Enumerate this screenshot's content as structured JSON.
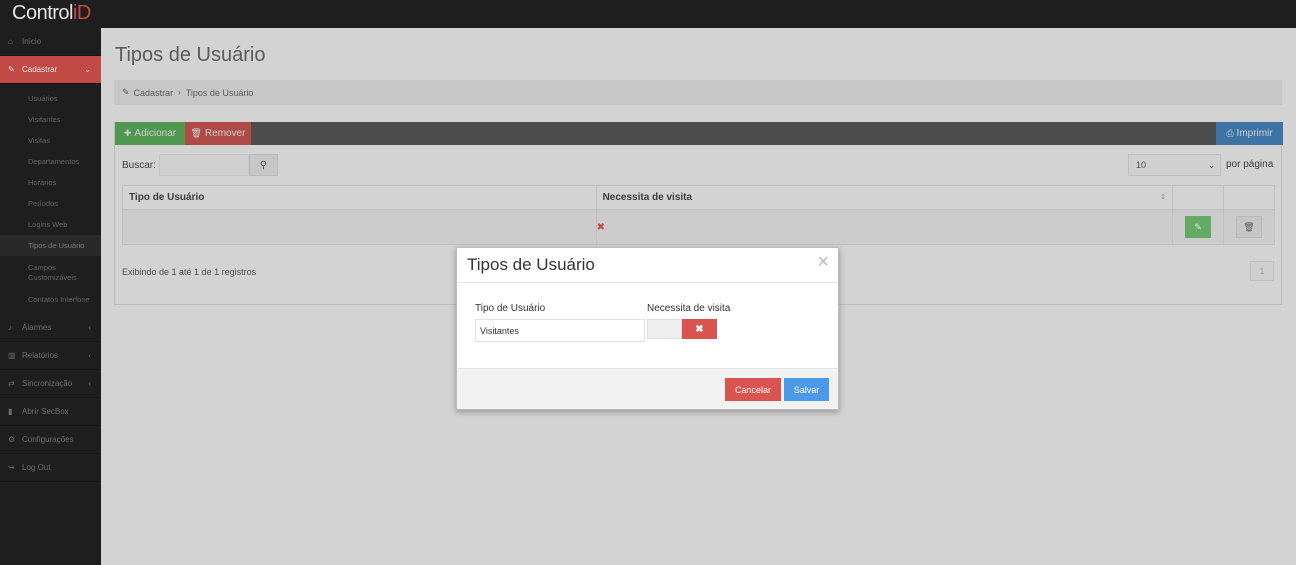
{
  "app": {
    "logo_text": "Control",
    "logo_accent": "iD"
  },
  "sidebar": {
    "items": [
      {
        "icon": "home-icon",
        "label": "Início"
      },
      {
        "icon": "edit-icon",
        "label": "Cadastrar"
      },
      {
        "icon": "bell-icon",
        "label": "Alarmes"
      },
      {
        "icon": "chart-icon",
        "label": "Relatórios"
      },
      {
        "icon": "shuffle-icon",
        "label": "Sincronização"
      },
      {
        "icon": "box-icon",
        "label": "Abrir SecBox"
      },
      {
        "icon": "gear-icon",
        "label": "Configurações"
      },
      {
        "icon": "logout-icon",
        "label": "Log Out"
      }
    ],
    "subitems": [
      "Usuários",
      "Visitantes",
      "Visitas",
      "Departamentos",
      "Horários",
      "Períodos",
      "Logins Web",
      "Tipos de Usuário",
      "Campos Customizáveis",
      "Contatos Interfone"
    ]
  },
  "page": {
    "title": "Tipos de Usuário",
    "breadcrumb": {
      "parent": "Cadastrar",
      "sep": "›",
      "current": "Tipos de Usuário"
    }
  },
  "toolbar": {
    "add_label": "Adicionar",
    "remove_label": "Remover",
    "print_label": "Imprimir"
  },
  "search": {
    "label": "Buscar:",
    "value": ""
  },
  "pagination": {
    "per_page_value": "10",
    "per_page_label": "por página",
    "current_page": "1"
  },
  "table": {
    "columns": [
      "Tipo de Usuário",
      "Necessita de visita"
    ],
    "rows": [
      {
        "tipo": "",
        "necessita_visita": "✖"
      }
    ],
    "info": "Exibindo de 1 até 1 de 1 registros"
  },
  "modal": {
    "title": "Tipos de Usuário",
    "field_tipo_label": "Tipo de Usuário",
    "field_tipo_value": "Visitantes",
    "field_visita_label": "Necessita de visita",
    "toggle_symbol": "✖",
    "cancel_label": "Cancelar",
    "save_label": "Salvar"
  },
  "colors": {
    "sidebar_bg": "#222222",
    "active": "#d9534f",
    "success": "#5cb85c",
    "primary": "#428bca",
    "save": "#4a9ae8"
  }
}
